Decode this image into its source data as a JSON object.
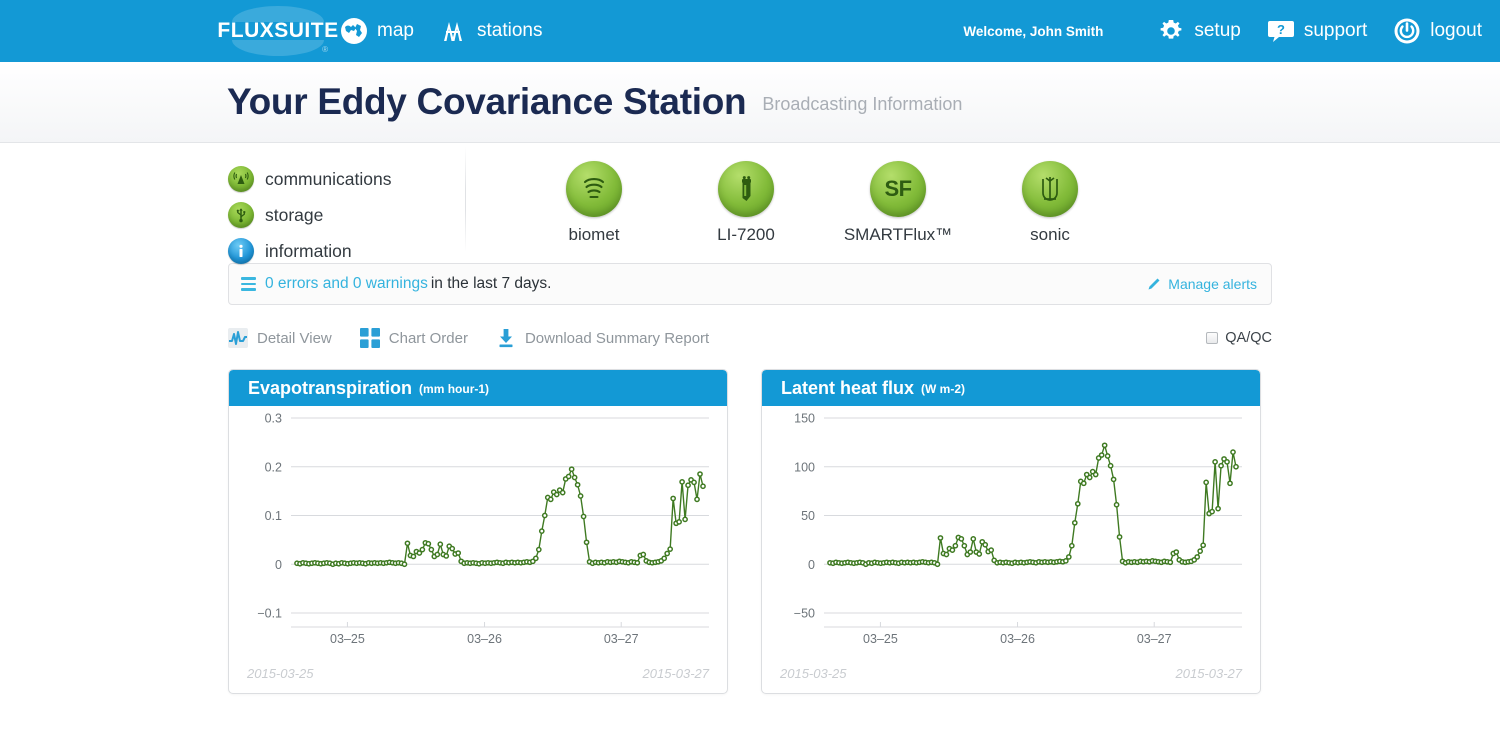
{
  "nav": {
    "logo": "FLUXSUITE",
    "logo_reg": "®",
    "left_items": [
      {
        "label": "map",
        "icon": "globe-icon"
      },
      {
        "label": "stations",
        "icon": "towers-icon"
      }
    ],
    "welcome": "Welcome, John Smith",
    "right_items": [
      {
        "label": "setup",
        "icon": "gear-icon"
      },
      {
        "label": "support",
        "icon": "help-bubble-icon"
      },
      {
        "label": "logout",
        "icon": "power-icon"
      }
    ]
  },
  "header": {
    "title": "Your Eddy Covariance Station",
    "subtitle": "Broadcasting Information"
  },
  "status": {
    "items": [
      {
        "label": "communications",
        "icon": "antenna-icon",
        "color": "#7cb733"
      },
      {
        "label": "storage",
        "icon": "usb-icon",
        "color": "#7cb733"
      },
      {
        "label": "information",
        "icon": "info-icon",
        "color": "#2196d8"
      }
    ]
  },
  "devices": [
    {
      "label": "biomet",
      "icon": "biomet-icon"
    },
    {
      "label": "LI-7200",
      "icon": "analyzer-icon"
    },
    {
      "label": "SMARTFlux™",
      "icon": "sf-icon",
      "glyph": "SF"
    },
    {
      "label": "sonic",
      "icon": "sonic-icon"
    }
  ],
  "alerts": {
    "count_text": "0 errors and 0 warnings",
    "rest_text": "in the last 7 days.",
    "manage_label": "Manage alerts",
    "manage_icon": "pencil-icon",
    "menu_icon": "hamburger-icon"
  },
  "toolbar": {
    "tools": [
      {
        "label": "Detail View",
        "icon": "chart-detail-icon"
      },
      {
        "label": "Chart Order",
        "icon": "grid-squares-icon"
      },
      {
        "label": "Download Summary Report",
        "icon": "download-icon"
      }
    ],
    "qaqc_label": "QA/QC",
    "qaqc_checked": false
  },
  "chart_data": [
    {
      "type": "line",
      "title": "Evapotranspiration",
      "units": "(mm hour-1)",
      "xlabel": "",
      "ylabel": "mm hour-1",
      "ylim": [
        -0.1,
        0.3
      ],
      "yticks": [
        0.3,
        0.2,
        0.1,
        0,
        -0.1
      ],
      "ytick_labels": [
        "0.3",
        "0.2",
        "0.1",
        "0",
        "−0.1"
      ],
      "xticks": [
        0.135,
        0.463,
        0.79
      ],
      "xtick_labels": [
        "03–25",
        "03–26",
        "03–27"
      ],
      "grid": true,
      "legend": "none",
      "start_date": "2015-03-25",
      "end_date": "2015-03-27",
      "series": [
        {
          "name": "Evapotranspiration",
          "color": "#3f7a22",
          "values": [
            0.002,
            0.001,
            0.003,
            0.002,
            0.001,
            0.002,
            0.003,
            0.002,
            0.001,
            0.002,
            0.003,
            0.002,
            0.0,
            0.002,
            0.001,
            0.003,
            0.002,
            0.001,
            0.002,
            0.003,
            0.002,
            0.003,
            0.002,
            0.001,
            0.003,
            0.002,
            0.003,
            0.002,
            0.003,
            0.002,
            0.003,
            0.004,
            0.003,
            0.002,
            0.003,
            0.002,
            0.0,
            0.043,
            0.018,
            0.016,
            0.026,
            0.023,
            0.03,
            0.044,
            0.042,
            0.03,
            0.016,
            0.02,
            0.041,
            0.02,
            0.017,
            0.037,
            0.032,
            0.021,
            0.023,
            0.006,
            0.002,
            0.003,
            0.002,
            0.003,
            0.002,
            0.001,
            0.003,
            0.002,
            0.003,
            0.002,
            0.003,
            0.004,
            0.003,
            0.002,
            0.004,
            0.003,
            0.004,
            0.003,
            0.004,
            0.003,
            0.004,
            0.005,
            0.004,
            0.006,
            0.012,
            0.03,
            0.068,
            0.1,
            0.137,
            0.133,
            0.148,
            0.143,
            0.152,
            0.147,
            0.175,
            0.18,
            0.195,
            0.178,
            0.163,
            0.14,
            0.098,
            0.045,
            0.005,
            0.002,
            0.004,
            0.003,
            0.004,
            0.003,
            0.005,
            0.004,
            0.005,
            0.004,
            0.006,
            0.005,
            0.004,
            0.003,
            0.005,
            0.004,
            0.003,
            0.018,
            0.02,
            0.007,
            0.004,
            0.003,
            0.004,
            0.005,
            0.007,
            0.012,
            0.022,
            0.031,
            0.135,
            0.084,
            0.087,
            0.169,
            0.092,
            0.162,
            0.173,
            0.168,
            0.133,
            0.185,
            0.16
          ]
        }
      ]
    },
    {
      "type": "line",
      "title": "Latent heat flux",
      "units": "(W m-2)",
      "xlabel": "",
      "ylabel": "W m-2",
      "ylim": [
        -50,
        150
      ],
      "yticks": [
        150,
        100,
        50,
        0,
        -50
      ],
      "ytick_labels": [
        "150",
        "100",
        "50",
        "0",
        "−50"
      ],
      "xticks": [
        0.135,
        0.463,
        0.79
      ],
      "xtick_labels": [
        "03–25",
        "03–26",
        "03–27"
      ],
      "grid": true,
      "legend": "none",
      "start_date": "2015-03-25",
      "end_date": "2015-03-27",
      "series": [
        {
          "name": "Latent heat flux",
          "color": "#3f7a22",
          "values": [
            1.5,
            1.0,
            2.0,
            1.5,
            1.0,
            1.5,
            2.0,
            1.5,
            1.0,
            1.5,
            2.0,
            1.5,
            0.0,
            1.5,
            1.0,
            2.0,
            1.5,
            1.0,
            1.5,
            2.0,
            1.5,
            2.0,
            1.5,
            1.0,
            2.0,
            1.5,
            2.0,
            1.5,
            2.0,
            1.5,
            2.0,
            2.5,
            2.0,
            1.5,
            2.0,
            1.5,
            0.0,
            27.0,
            11.0,
            10.0,
            16.0,
            14.5,
            19.0,
            27.5,
            26.0,
            19.0,
            10.0,
            12.5,
            26.0,
            12.5,
            10.5,
            23.0,
            20.0,
            13.0,
            14.5,
            4.0,
            1.5,
            2.0,
            1.5,
            2.0,
            1.5,
            1.0,
            2.0,
            1.5,
            2.0,
            1.5,
            2.0,
            2.5,
            2.0,
            1.5,
            2.5,
            2.0,
            2.5,
            2.0,
            2.5,
            2.0,
            2.5,
            3.0,
            2.5,
            3.5,
            7.5,
            19.0,
            42.5,
            62.0,
            85.0,
            83.0,
            92.0,
            89.0,
            95.0,
            92.0,
            109.0,
            112.0,
            122.0,
            111.0,
            101.0,
            87.0,
            61.0,
            28.0,
            3.0,
            1.5,
            2.5,
            2.0,
            2.5,
            2.0,
            3.0,
            2.5,
            3.0,
            2.5,
            3.5,
            3.0,
            2.5,
            2.0,
            3.0,
            2.5,
            2.0,
            11.0,
            12.5,
            4.5,
            2.5,
            2.0,
            2.5,
            3.0,
            4.5,
            7.5,
            13.5,
            19.5,
            84.0,
            52.0,
            54.0,
            105.0,
            57.0,
            101.0,
            108.0,
            105.0,
            83.0,
            115.0,
            100.0
          ]
        }
      ]
    }
  ]
}
